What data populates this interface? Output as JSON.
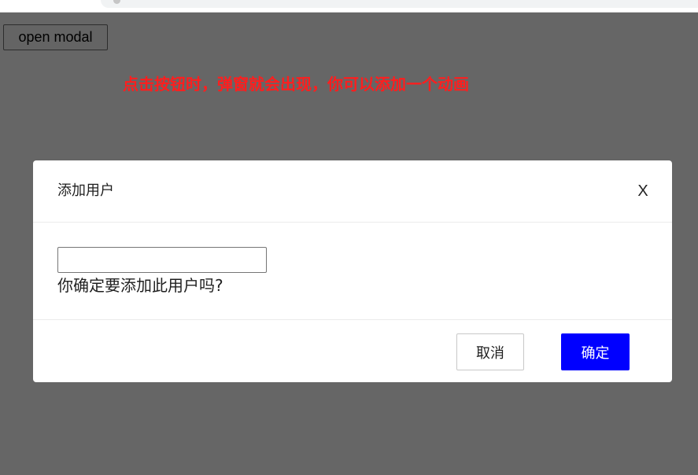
{
  "page": {
    "open_button_label": "open modal",
    "hint_text": "点击按钮时，弹窗就会出现，你可以添加一个动画"
  },
  "modal": {
    "title": "添加用户",
    "close_label": "X",
    "input_value": "",
    "confirm_text": "你确定要添加此用户吗?",
    "cancel_label": "取消",
    "ok_label": "确定"
  },
  "colors": {
    "overlay": "#666666",
    "hint": "#ff1e1e",
    "primary": "#0000ff"
  }
}
